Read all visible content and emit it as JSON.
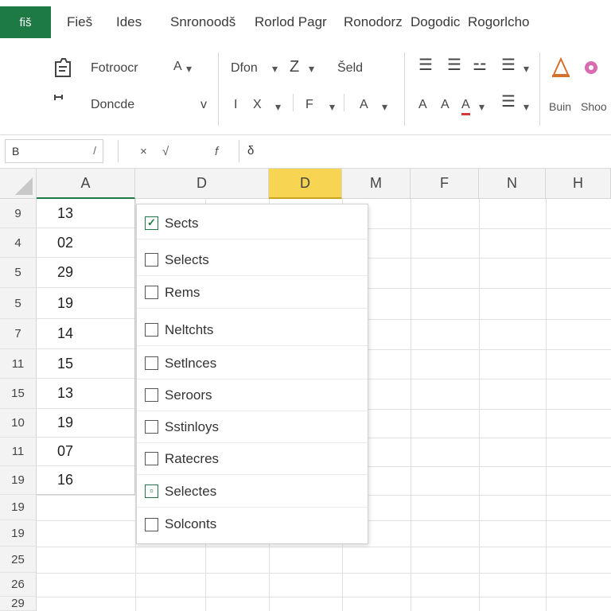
{
  "app": {
    "badge": "fiš"
  },
  "menu": {
    "tabs": [
      "Fieš",
      "Ides",
      "Snronoodš",
      "Rorlod Pagr",
      "Ronodorz",
      "Dogodic",
      "Rogorlcho"
    ]
  },
  "ribbon": {
    "row1": {
      "paste_label": "Fotroocr",
      "font_size": "A",
      "font_size_caret": "▾",
      "font_name": "Dfon",
      "font_name_caret": "▾",
      "italic": "Z",
      "italic_caret": "▾",
      "style_label": "Šeld",
      "align_left": "☰",
      "align_center": "☰",
      "wrap": "⚍",
      "list": "☰",
      "list_caret": "▾",
      "right_label_a": "Bvin",
      "right_label_b": "Shoo"
    },
    "row2": {
      "clipboard_label": "Doncde",
      "clipboard_caret": "v",
      "bold": "I",
      "format_x": "X",
      "format_caret": "▾",
      "ft": "F",
      "ft_caret": "▾",
      "size_a": "A",
      "size_caret": "▾",
      "a1": "A",
      "a2": "A",
      "a3": "A",
      "a3_caret": "▾",
      "align_bottom": "☰",
      "align_bottom_caret": "▾",
      "right_label_a": "Buin",
      "right_label_b": "Shoo"
    }
  },
  "formula_bar": {
    "name_box": "B",
    "name_caret": "/",
    "cancel": "×",
    "confirm": "√",
    "fx": "f",
    "value": "δ"
  },
  "grid": {
    "columns": [
      "A",
      "D",
      "D",
      "M",
      "F",
      "N",
      "H"
    ],
    "active_column_index": 2,
    "row_numbers": [
      "9",
      "4",
      "5",
      "5",
      "7",
      "11",
      "15",
      "10",
      "11",
      "19",
      "19",
      "19",
      "25",
      "26",
      "29"
    ],
    "column_a_values": [
      "13",
      "02",
      "29",
      "19",
      "14",
      "15",
      "13",
      "19",
      "07",
      "16"
    ]
  },
  "dropdown": {
    "items": [
      {
        "label": "Sects",
        "checked": true
      },
      {
        "label": "Selects",
        "checked": false
      },
      {
        "label": "Rems",
        "checked": false
      },
      {
        "label": "Neltchts",
        "checked": false
      },
      {
        "label": "Setlnces",
        "checked": false
      },
      {
        "label": "Seroors",
        "checked": false
      },
      {
        "label": "Sstinloys",
        "checked": false
      },
      {
        "label": "Ratecres",
        "checked": false
      },
      {
        "label": "Selectes",
        "checked": true
      },
      {
        "label": "Solconts",
        "checked": false
      }
    ]
  },
  "colors": {
    "brand": "#1e7a45",
    "active_column": "#f7d452"
  }
}
